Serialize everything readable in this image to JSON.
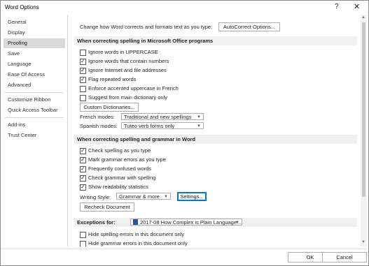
{
  "window": {
    "title": "Word Options",
    "help": "?",
    "close": "✕"
  },
  "sidebar": {
    "items": [
      {
        "label": "General"
      },
      {
        "label": "Display"
      },
      {
        "label": "Proofing"
      },
      {
        "label": "Save"
      },
      {
        "label": "Language"
      },
      {
        "label": "Ease Of Access"
      },
      {
        "label": "Advanced"
      },
      {
        "label": "Customize Ribbon"
      },
      {
        "label": "Quick Access Toolbar"
      },
      {
        "label": "Add-ins"
      },
      {
        "label": "Trust Center"
      }
    ],
    "selected": "Proofing"
  },
  "autocorrect": {
    "label": "Change how Word corrects and formats text as you type:",
    "button": "AutoCorrect Options..."
  },
  "office_section": {
    "heading": "When correcting spelling in Microsoft Office programs",
    "options": [
      {
        "label": "Ignore words in UPPERCASE",
        "checked": false
      },
      {
        "label": "Ignore words that contain numbers",
        "checked": true
      },
      {
        "label": "Ignore Internet and file addresses",
        "checked": true
      },
      {
        "label": "Flag repeated words",
        "checked": true
      },
      {
        "label": "Enforce accented uppercase in French",
        "checked": false
      },
      {
        "label": "Suggest from main dictionary only",
        "checked": false
      }
    ],
    "custom_dict_button": "Custom Dictionaries...",
    "french_label": "French modes:",
    "french_value": "Traditional and new spellings",
    "spanish_label": "Spanish modes:",
    "spanish_value": "Tuteo verb forms only"
  },
  "word_section": {
    "heading": "When correcting spelling and grammar in Word",
    "options": [
      {
        "label": "Check spelling as you type",
        "checked": true
      },
      {
        "label": "Mark grammar errors as you type",
        "checked": true
      },
      {
        "label": "Frequently confused words",
        "checked": true
      },
      {
        "label": "Check grammar with spelling",
        "checked": true
      },
      {
        "label": "Show readability statistics",
        "checked": true
      }
    ],
    "writing_style_label": "Writing Style:",
    "writing_style_value": "Grammar & more",
    "settings_button": "Settings...",
    "recheck_button": "Recheck Document"
  },
  "exceptions": {
    "label": "Exceptions for:",
    "document": "2017-08 How Complex is Plain Language...",
    "options": [
      {
        "label": "Hide spelling errors in this document only",
        "checked": false
      },
      {
        "label": "Hide grammar errors in this document only",
        "checked": false
      }
    ]
  },
  "footer": {
    "ok": "OK",
    "cancel": "Cancel"
  }
}
